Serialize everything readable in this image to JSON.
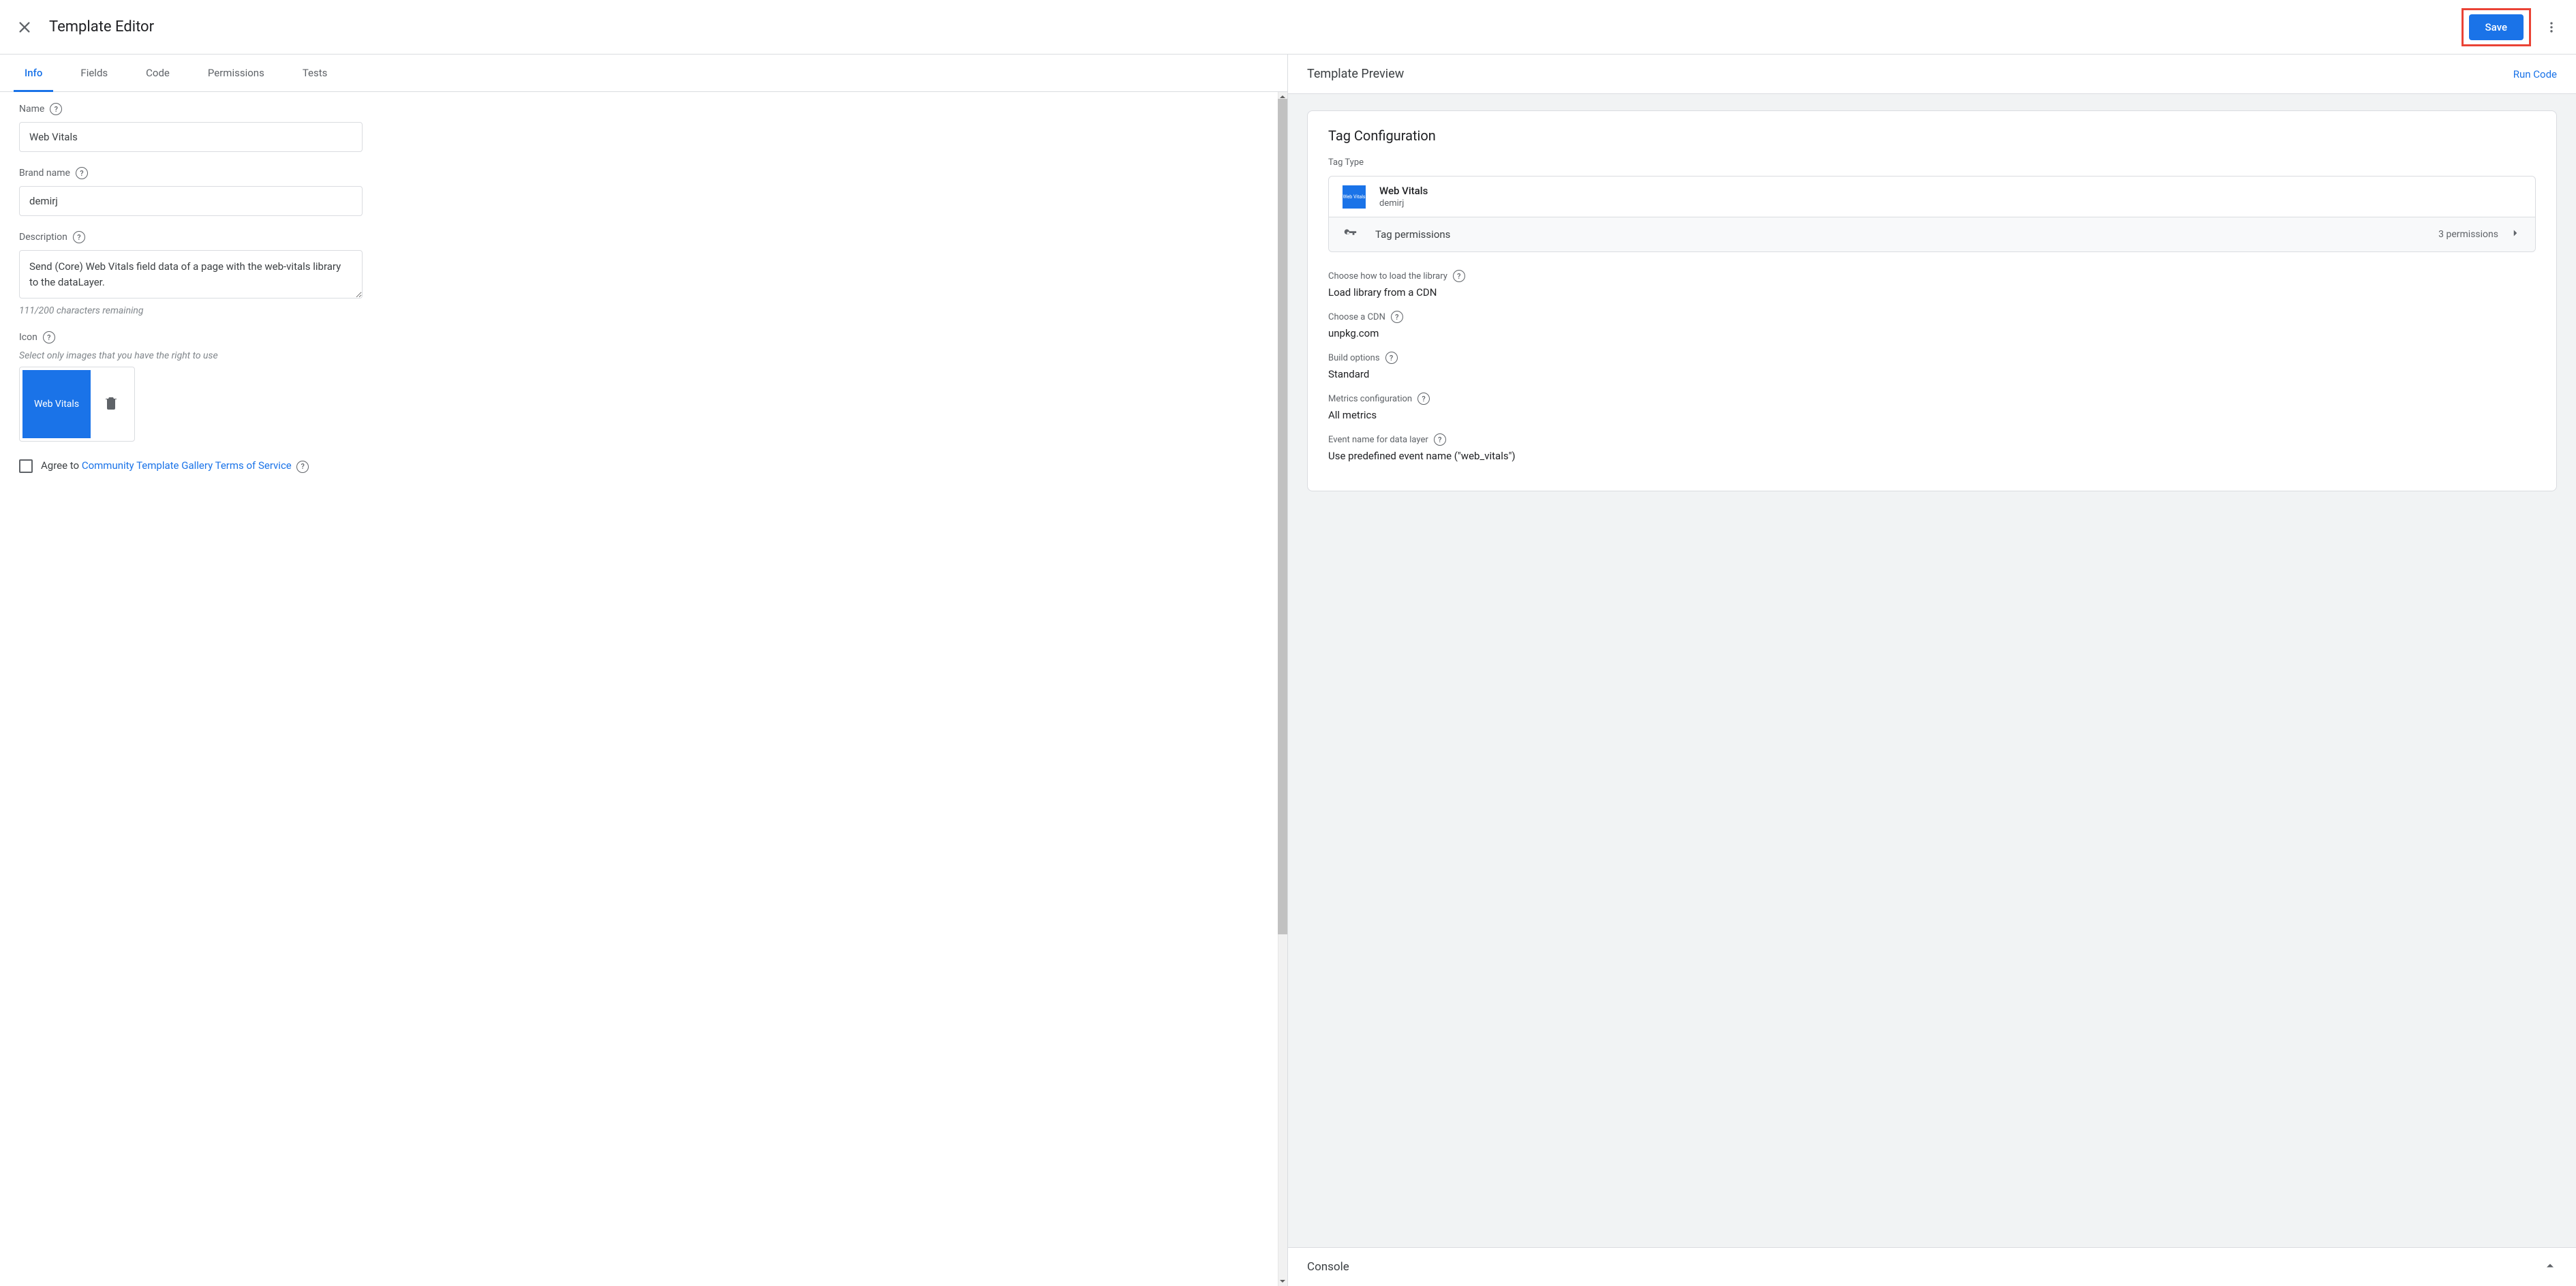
{
  "header": {
    "title": "Template Editor",
    "save_label": "Save"
  },
  "tabs": [
    "Info",
    "Fields",
    "Code",
    "Permissions",
    "Tests"
  ],
  "form": {
    "name_label": "Name",
    "name_value": "Web Vitals",
    "brand_label": "Brand name",
    "brand_value": "demirj",
    "desc_label": "Description",
    "desc_value": "Send (Core) Web Vitals field data of a page with the web-vitals library to the dataLayer.",
    "desc_hint": "111/200 characters remaining",
    "icon_label": "Icon",
    "icon_hint": "Select only images that you have the right to use",
    "icon_thumb_text": "Web Vitals",
    "agree_prefix": "Agree to ",
    "agree_link": "Community Template Gallery Terms of Service"
  },
  "preview": {
    "header": "Template Preview",
    "run_code": "Run Code",
    "card_title": "Tag Configuration",
    "tag_type_label": "Tag Type",
    "tag_name": "Web Vitals",
    "tag_brand": "demirj",
    "logo_text": "Web Vitals",
    "permissions_label": "Tag permissions",
    "permissions_count": "3 permissions",
    "options": [
      {
        "label": "Choose how to load the library",
        "value": "Load library from a CDN",
        "help": true
      },
      {
        "label": "Choose a CDN",
        "value": "unpkg.com",
        "help": true
      },
      {
        "label": "Build options",
        "value": "Standard",
        "help": true
      },
      {
        "label": "Metrics configuration",
        "value": "All metrics",
        "help": true
      },
      {
        "label": "Event name for data layer",
        "value": "Use predefined event name (\"web_vitals\")",
        "help": true
      }
    ],
    "console": "Console"
  }
}
